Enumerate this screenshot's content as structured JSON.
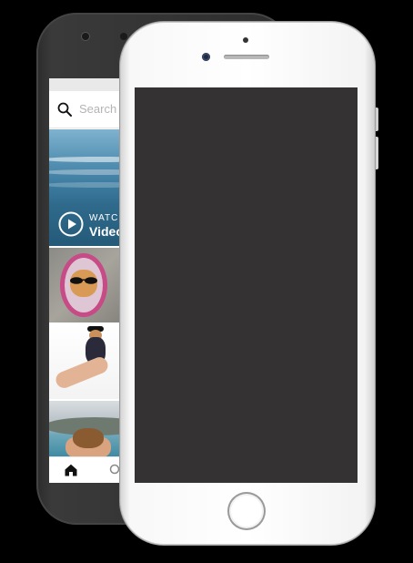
{
  "back_phone": {
    "search": {
      "placeholder": "Search"
    },
    "feed": {
      "video_tile": {
        "watch_label": "WATCH",
        "title": "Video"
      },
      "photo_tiles": [
        "cat-in-mirror",
        "dog-held-up",
        "burger-at-beach"
      ]
    },
    "bottom_nav": [
      "home-icon",
      "explore-icon"
    ]
  },
  "front_phone": {
    "screen_color": "#343233"
  }
}
